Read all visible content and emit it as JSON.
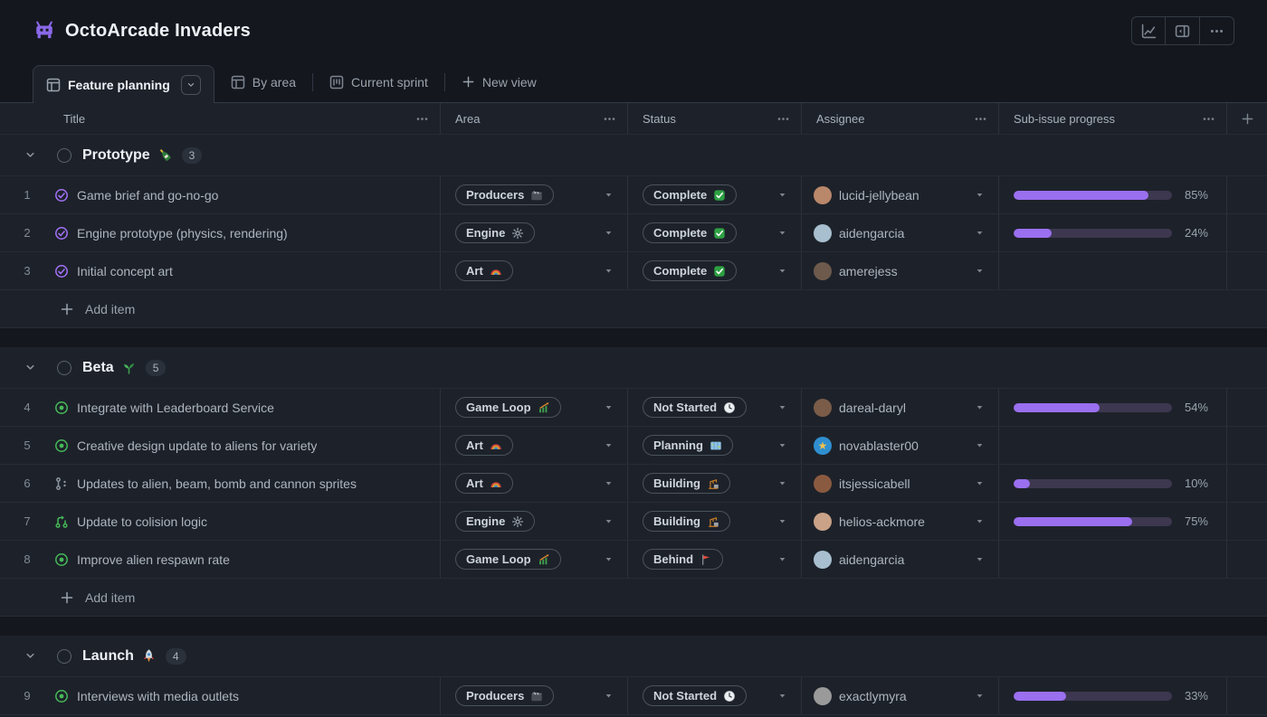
{
  "window": {
    "title": "OctoArcade Invaders",
    "logo_emoji": "👾"
  },
  "toolbar": {
    "buttons": [
      "insights-chart",
      "side-panel",
      "more-options"
    ]
  },
  "tabs": {
    "active": {
      "label": "Feature planning",
      "icon": "table-icon"
    },
    "others": [
      {
        "label": "By area",
        "icon": "table-icon"
      },
      {
        "label": "Current sprint",
        "icon": "project-icon"
      }
    ],
    "new_view_label": "New view"
  },
  "table": {
    "columns": [
      {
        "label": "Title"
      },
      {
        "label": "Area"
      },
      {
        "label": "Status"
      },
      {
        "label": "Assignee"
      },
      {
        "label": "Sub-issue progress"
      }
    ],
    "add_item_label": "Add item",
    "groups": [
      {
        "name": "Prototype",
        "emoji": "🍾",
        "count": "3",
        "rows": [
          {
            "num": "1",
            "state": "closed-issue",
            "title": "Game brief and go-no-go",
            "area": {
              "label": "Producers",
              "emoji": "🎬"
            },
            "status": {
              "label": "Complete",
              "emoji": "✅"
            },
            "assignee": {
              "name": "lucid-jellybean",
              "avatar_color": "#b9876a"
            },
            "progress": {
              "value": 85,
              "text": "85%"
            }
          },
          {
            "num": "2",
            "state": "closed-issue",
            "title": "Engine prototype (physics, rendering)",
            "area": {
              "label": "Engine",
              "emoji": "⚙️"
            },
            "status": {
              "label": "Complete",
              "emoji": "✅"
            },
            "assignee": {
              "name": "aidengarcia",
              "avatar_color": "#a8bfcf"
            },
            "progress": {
              "value": 24,
              "text": "24%"
            }
          },
          {
            "num": "3",
            "state": "closed-issue",
            "title": "Initial concept art",
            "area": {
              "label": "Art",
              "emoji": "🌈"
            },
            "status": {
              "label": "Complete",
              "emoji": "✅"
            },
            "assignee": {
              "name": "amerejess",
              "avatar_color": "#6e5a4c"
            },
            "progress": null
          }
        ]
      },
      {
        "name": "Beta",
        "emoji": "🌱",
        "count": "5",
        "rows": [
          {
            "num": "4",
            "state": "open-issue",
            "title": "Integrate with Leaderboard Service",
            "area": {
              "label": "Game Loop",
              "emoji": "📈"
            },
            "status": {
              "label": "Not Started",
              "emoji": "🕐"
            },
            "assignee": {
              "name": "dareal-daryl",
              "avatar_color": "#7a5c48"
            },
            "progress": {
              "value": 54,
              "text": "54%"
            }
          },
          {
            "num": "5",
            "state": "open-issue",
            "title": "Creative design update to aliens for variety",
            "area": {
              "label": "Art",
              "emoji": "🌈"
            },
            "status": {
              "label": "Planning",
              "emoji": "🗺️"
            },
            "assignee": {
              "name": "novablaster00",
              "avatar_color": "#2f8fd0",
              "avatar_glyph": "★"
            },
            "progress": null
          },
          {
            "num": "6",
            "state": "draft-pull-request",
            "title": "Updates to alien, beam, bomb and cannon sprites",
            "area": {
              "label": "Art",
              "emoji": "🌈"
            },
            "status": {
              "label": "Building",
              "emoji": "🏗️"
            },
            "assignee": {
              "name": "itsjessicabell",
              "avatar_color": "#8a5a40"
            },
            "progress": {
              "value": 10,
              "text": "10%"
            }
          },
          {
            "num": "7",
            "state": "open-pull-request",
            "title": "Update to colision logic",
            "area": {
              "label": "Engine",
              "emoji": "⚙️"
            },
            "status": {
              "label": "Building",
              "emoji": "🏗️"
            },
            "assignee": {
              "name": "helios-ackmore",
              "avatar_color": "#caa287"
            },
            "progress": {
              "value": 75,
              "text": "75%"
            }
          },
          {
            "num": "8",
            "state": "open-issue",
            "title": "Improve alien respawn rate",
            "area": {
              "label": "Game Loop",
              "emoji": "📈"
            },
            "status": {
              "label": "Behind",
              "emoji": "🚩"
            },
            "assignee": {
              "name": "aidengarcia",
              "avatar_color": "#a8bfcf"
            },
            "progress": null
          }
        ]
      },
      {
        "name": "Launch",
        "emoji": "🚀",
        "count": "4",
        "rows": [
          {
            "num": "9",
            "state": "open-issue",
            "title": "Interviews with media outlets",
            "area": {
              "label": "Producers",
              "emoji": "🎬"
            },
            "status": {
              "label": "Not Started",
              "emoji": "🕐"
            },
            "assignee": {
              "name": "exactlymyra",
              "avatar_color": "#9a9a9a"
            },
            "progress": {
              "value": 33,
              "text": "33%"
            }
          }
        ]
      }
    ]
  }
}
